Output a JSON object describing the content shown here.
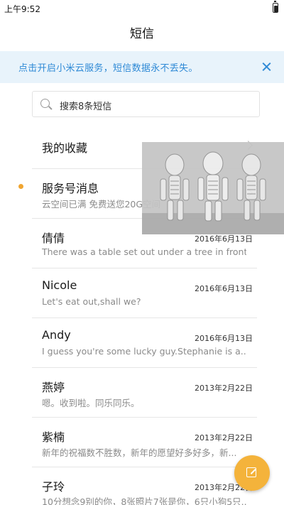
{
  "status_bar": {
    "time": "上午9:52",
    "battery_icon": "battery-charging-icon"
  },
  "header": {
    "title": "短信"
  },
  "banner": {
    "text": "点击开启小米云服务，短信数据永不丢失。",
    "close_icon": "close-icon",
    "color": "#2f8ad6"
  },
  "search": {
    "placeholder": "搜索8条短信",
    "icon": "search-icon"
  },
  "favorites": {
    "title": "我的收藏"
  },
  "service": {
    "title": "服务号消息",
    "subtitle": "云空间已满 免费送您20G空间",
    "unread_color": "#f0a531"
  },
  "conversations": [
    {
      "name": "倩倩",
      "date": "2016年6月13日",
      "preview": "There was a table set out under a tree in front..."
    },
    {
      "name": "Nicole",
      "date": "2016年6月13日",
      "preview": "Let's eat out,shall we?"
    },
    {
      "name": "Andy",
      "date": "2016年6月13日",
      "preview": "I guess you're some lucky guy.Stephanie is a..."
    },
    {
      "name": "燕婷",
      "date": "2013年2月22日",
      "preview": "嗯。收到啦。同乐同乐。"
    },
    {
      "name": "紫楠",
      "date": "2013年2月22日",
      "preview": "新年的祝福数不胜数，新年的愿望好多好多，新..."
    },
    {
      "name": "子玲",
      "date": "2013年2月22日",
      "preview": "10分想念9别的你，8张照片7张是你，6只小狗5只..."
    }
  ],
  "fab": {
    "icon": "compose-icon",
    "color": "#f4b33b"
  }
}
